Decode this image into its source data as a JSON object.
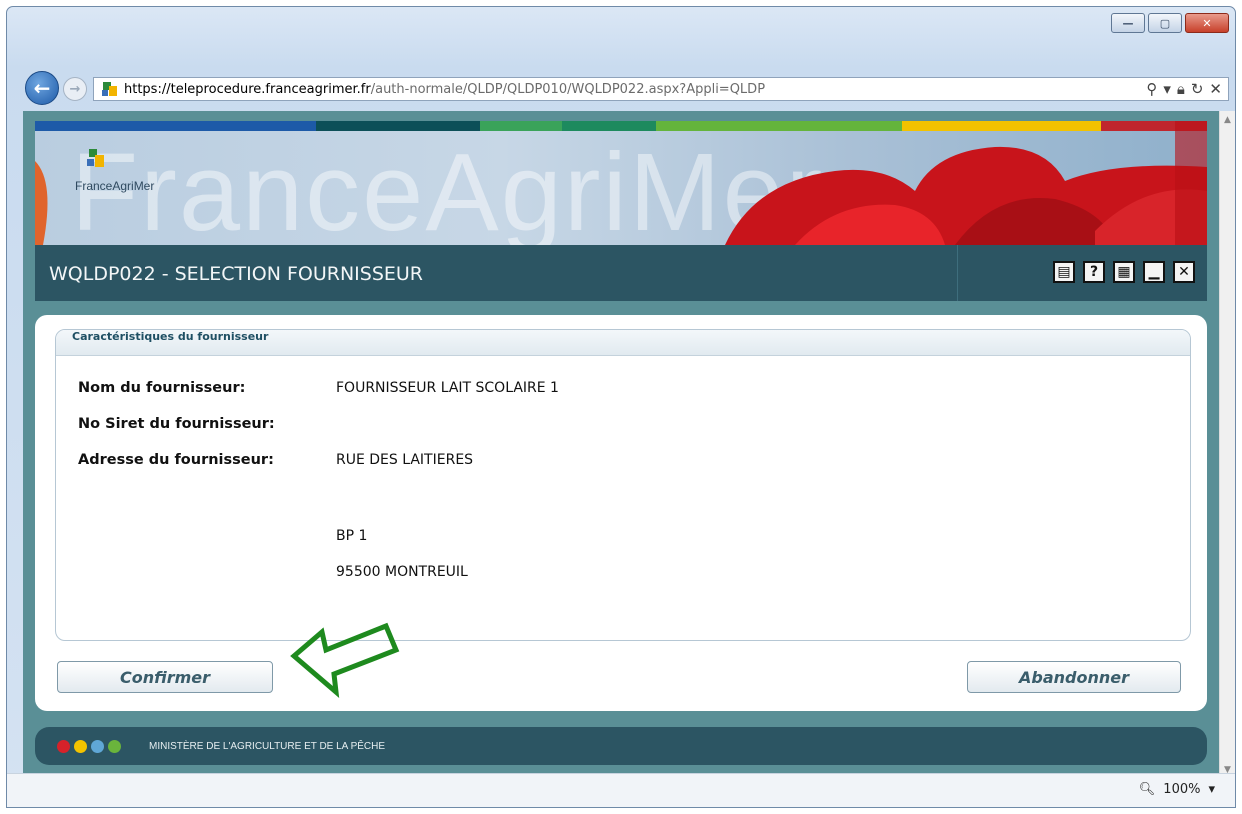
{
  "browser": {
    "url_host": "https://teleprocedure.franceagrimer.fr",
    "url_path": "/auth-normale/QLDP/QLDP010/WQLDP022.aspx?Appli=QLDP",
    "zoom": "100%"
  },
  "banner": {
    "word": "FranceAgriMer",
    "logo_text": "FranceAgriMer",
    "stripe_colors": [
      "#1d5aa8",
      "#0c4f58",
      "#3aa35a",
      "#1d8a5e",
      "#64b43c",
      "#f2c200",
      "#c0262d"
    ]
  },
  "header": {
    "title": "WQLDP022 - SELECTION FOURNISSEUR"
  },
  "form": {
    "legend": "Caractéristiques du fournisseur",
    "name_label": "Nom du fournisseur:",
    "name_value": "FOURNISSEUR LAIT SCOLAIRE 1",
    "siret_label": "No Siret du fournisseur:",
    "siret_value": "",
    "address_label": "Adresse du fournisseur:",
    "address_line1": "RUE DES LAITIERES",
    "address_line2": "BP 1",
    "address_line3": "95500  MONTREUIL"
  },
  "buttons": {
    "confirm": "Confirmer",
    "cancel": "Abandonner"
  },
  "footer": {
    "text": "MINISTÈRE DE L'AGRICULTURE ET DE LA PÊCHE",
    "dot_colors": [
      "#d6222a",
      "#f3c300",
      "#5fa7d6",
      "#6ab43c"
    ]
  },
  "colors": {
    "header_bg": "#2c5563",
    "page_bg": "#5a8f96",
    "arrow": "#1e8a1e"
  }
}
